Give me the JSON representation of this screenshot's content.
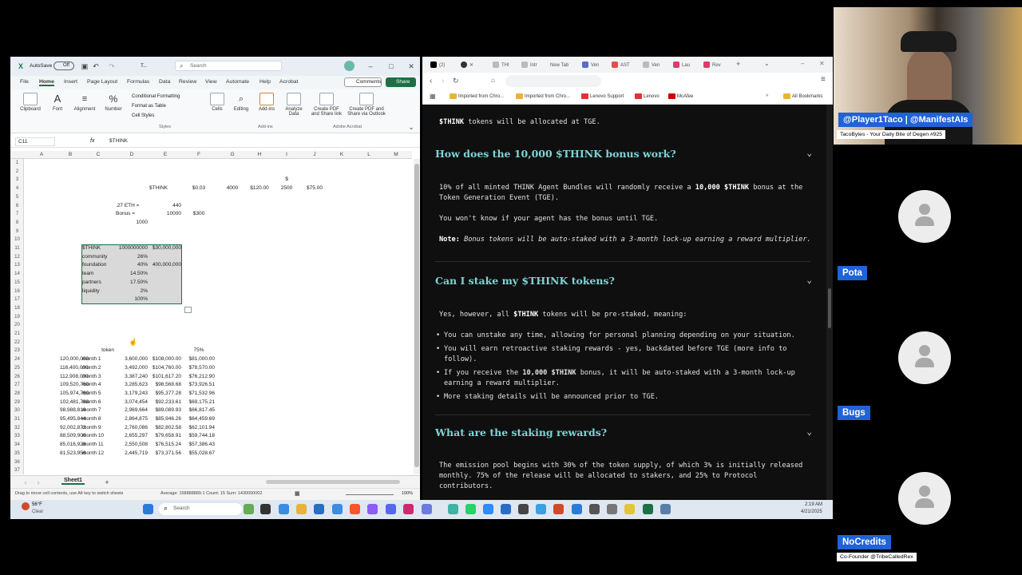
{
  "excel": {
    "autosave_label": "AutoSave",
    "autosave_state": "Off",
    "title": "T...",
    "search_placeholder": "Search",
    "menus": [
      "File",
      "Home",
      "Insert",
      "Page Layout",
      "Formulas",
      "Data",
      "Review",
      "View",
      "Automate",
      "Help",
      "Acrobat"
    ],
    "comments_label": "Comments",
    "share_label": "Share",
    "ribbon": {
      "clipboard": "Clipboard",
      "font": "Font",
      "alignment": "Alignment",
      "number": "Number",
      "conditional": "Conditional Formatting",
      "format_table": "Format as Table",
      "cell_styles": "Cell Styles",
      "styles_group": "Styles",
      "cells": "Cells",
      "editing": "Editing",
      "addins": "Add-ins",
      "addins_group": "Add-ins",
      "analyze": "Analyze Data",
      "pdf_share": "Create PDF and Share link",
      "pdf_outlook": "Create PDF and Share via Outlook",
      "acrobat_group": "Adobe Acrobat"
    },
    "name_box": "C11",
    "formula": "$THINK",
    "fx": "fx",
    "columns": [
      "A",
      "B",
      "C",
      "D",
      "E",
      "F",
      "G",
      "H",
      "I",
      "J",
      "K",
      "L",
      "M"
    ],
    "rows": [
      "1",
      "2",
      "3",
      "4",
      "5",
      "6",
      "7",
      "8",
      "9",
      "10",
      "11",
      "12",
      "13",
      "14",
      "15",
      "16",
      "17",
      "18",
      "19",
      "20",
      "21",
      "22",
      "23",
      "24",
      "25",
      "26",
      "27",
      "28",
      "29",
      "30",
      "31",
      "32",
      "33",
      "34",
      "35",
      "36",
      "37"
    ],
    "cells": {
      "r3i": "$",
      "r4e": "$THINK",
      "r4f": "$0.03",
      "r4g": "4000",
      "r4h": "$120.00",
      "r4i": "2500",
      "r4j": "$75.00",
      "r6d": ".27 ETH =",
      "r6e": "440",
      "r7d": "Bonus =",
      "r7e": "10000",
      "r7f": "$300",
      "r8d": "1000",
      "r23c": "token",
      "r23f": "75%"
    },
    "alloc": [
      {
        "label": "$THINK",
        "pct": "1000000000",
        "amt": "$30,000,000"
      },
      {
        "label": "community",
        "pct": "26%",
        "amt": ""
      },
      {
        "label": "foundation",
        "pct": "40%",
        "amt": "400,000,000"
      },
      {
        "label": "team",
        "pct": "14.50%",
        "amt": ""
      },
      {
        "label": "partners",
        "pct": "17.50%",
        "amt": ""
      },
      {
        "label": "liquidity",
        "pct": "2%",
        "amt": ""
      },
      {
        "label": "",
        "pct": "100%",
        "amt": ""
      }
    ],
    "months": [
      {
        "b": "120,000,000",
        "c": "month 1",
        "d": "3,600,000",
        "e": "$108,000.00",
        "f": "$81,000.00"
      },
      {
        "b": "116,400,000",
        "c": "month 2",
        "d": "3,492,000",
        "e": "$104,760.00",
        "f": "$78,570.00"
      },
      {
        "b": "112,908,000",
        "c": "month 3",
        "d": "3,387,240",
        "e": "$101,617.20",
        "f": "$76,212.90"
      },
      {
        "b": "109,520,760",
        "c": "month 4",
        "d": "3,285,623",
        "e": "$98,568.68",
        "f": "$73,926.51"
      },
      {
        "b": "105,974,760",
        "c": "month 5",
        "d": "3,179,243",
        "e": "$95,377.28",
        "f": "$71,532.96"
      },
      {
        "b": "102,481,788",
        "c": "month 6",
        "d": "3,074,454",
        "e": "$92,233.61",
        "f": "$69,175.21"
      },
      {
        "b": "98,988,816",
        "c": "month 7",
        "d": "2,969,664",
        "e": "$89,089.93",
        "f": "$66,817.45"
      },
      {
        "b": "95,495,844",
        "c": "month 8",
        "d": "2,864,875",
        "e": "$85,946.26",
        "f": "$64,459.69"
      },
      {
        "b": "92,002,872",
        "c": "month 9",
        "d": "2,760,086",
        "e": "$82,802.58",
        "f": "$62,101.94"
      },
      {
        "b": "88,509,900",
        "c": "month 10",
        "d": "2,655,297",
        "e": "$79,658.91",
        "f": "$59,744.18"
      },
      {
        "b": "85,016,928",
        "c": "month 11",
        "d": "2,550,508",
        "e": "$76,515.24",
        "f": "$57,386.43"
      },
      {
        "b": "81,523,956",
        "c": "month 12",
        "d": "2,445,719",
        "e": "$73,371.56",
        "f": "$55,028.67"
      }
    ],
    "sheet_tab": "Sheet1",
    "status_left": "Drag to move cell contents, use Alt key to switch sheets",
    "status_stats": "Average: 158888889.1   Count: 15   Sum: 1430000002",
    "zoom": "100%"
  },
  "browser": {
    "tabs": [
      "(2)",
      "THI",
      "Intr",
      "New Tab",
      "Ven",
      "AST",
      "Ven",
      "Lau",
      "Rev"
    ],
    "bookmarks": [
      "Imported from Chro...",
      "Imported from Chro...",
      "Lenovo Support",
      "Lenovo",
      "McAfee"
    ],
    "all_bookmarks": "All Bookmarks",
    "page": {
      "intro": "$THINK tokens will be allocated at TGE.",
      "q1": "How does the 10,000 $THINK bonus work?",
      "a1_p1": "10% of all minted THINK Agent Bundles will randomly receive a 10,000 $THINK bonus at the Token Generation Event (TGE).",
      "a1_p2": "You won't know if your agent has the bonus until TGE.",
      "a1_note_label": "Note:",
      "a1_note": "Bonus tokens will be auto-staked with a 3-month lock-up earning a reward multiplier.",
      "q2": "Can I stake my $THINK tokens?",
      "a2_p1": "Yes, however, all $THINK tokens will be pre-staked, meaning:",
      "a2_b1": "You can unstake any time, allowing for personal planning depending on your situation.",
      "a2_b2": "You will earn retroactive staking rewards - yes, backdated before TGE (more info to follow).",
      "a2_b3": "If you receive the 10,000 $THINK bonus, it will be auto-staked with a 3-month lock-up earning a reward multiplier.",
      "a2_b4": "More staking details will be announced prior to TGE.",
      "q3": "What are the staking rewards?",
      "a3_p1": "The emission pool begins with 30% of the token supply, of which 3% is initially released monthly. 75% of the release will be allocated to stakers, and 25% to Protocol contributors."
    }
  },
  "taskbar": {
    "weather_temp": "56°F",
    "weather_desc": "Clear",
    "search": "Search",
    "time": "2:19 AM",
    "date": "4/21/2025"
  },
  "participants": {
    "host_tag": "@Player1Taco | @ManifestAIs",
    "host_sub": "TacoBytes - Your Daily Bite of Degen #925",
    "p1": "Pota",
    "p2": "Bugs",
    "p3": "NoCredits",
    "p3_sub": "Co-Founder @TribeCalledRex"
  }
}
